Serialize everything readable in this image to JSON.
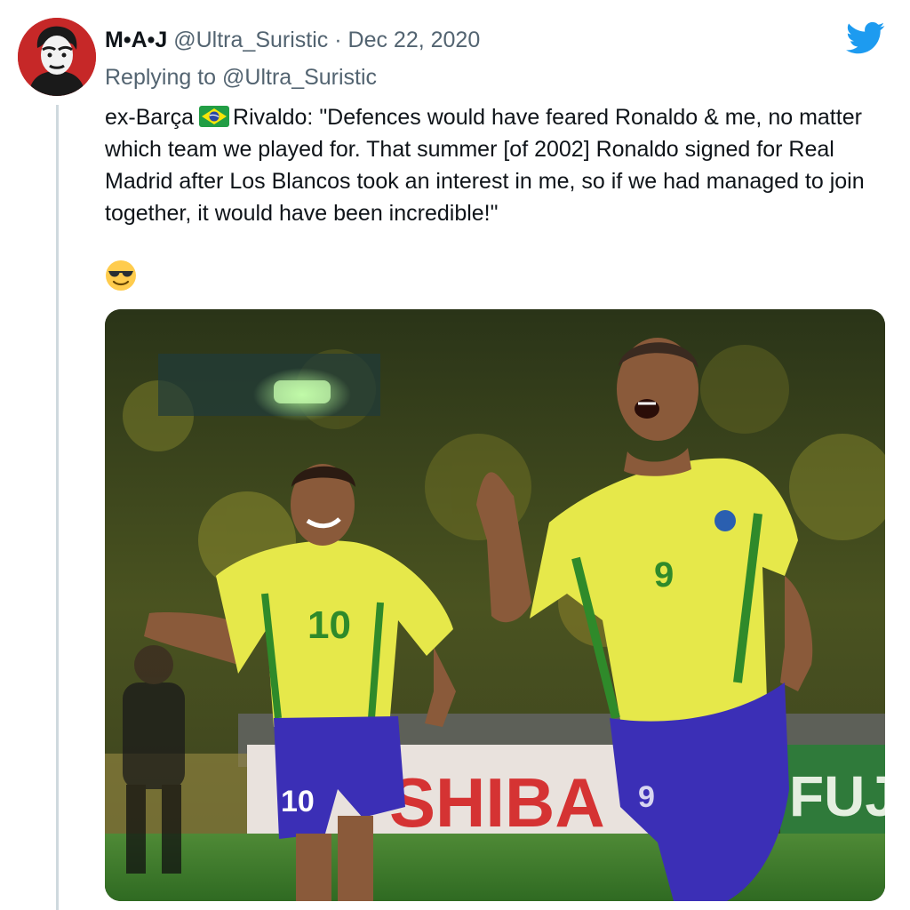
{
  "tweet": {
    "author_name": "M•A•J",
    "handle": "@Ultra_Suristic",
    "separator": "·",
    "date": "Dec 22, 2020",
    "reply_prefix": "Replying to",
    "reply_mention": "@Ultra_Suristic",
    "text_before_flag": "ex-Barça",
    "text_after_flag": "Rivaldo: \"Defences would have feared Ronaldo & me, no matter which team we played for. That summer [of 2002] Ronaldo signed for Real Madrid after Los Blancos took an interest in me, so if we had managed to join together, it would have been incredible!\"",
    "emoji": "sunglasses-emoji",
    "flag": "brazil-flag"
  },
  "media": {
    "left_player_number": "10",
    "right_player_number": "9",
    "board_text": "SHIBA",
    "board_text_right": "FUJ"
  },
  "icons": {
    "logo": "twitter-bird-icon",
    "avatar": "profile-avatar"
  },
  "colors": {
    "text": "#0f1419",
    "secondary": "#536471",
    "twitter_blue": "#1d9bf0",
    "avatar_red": "#c62828",
    "jersey_yellow": "#e6e84a",
    "shorts_blue": "#3b2fb6"
  }
}
